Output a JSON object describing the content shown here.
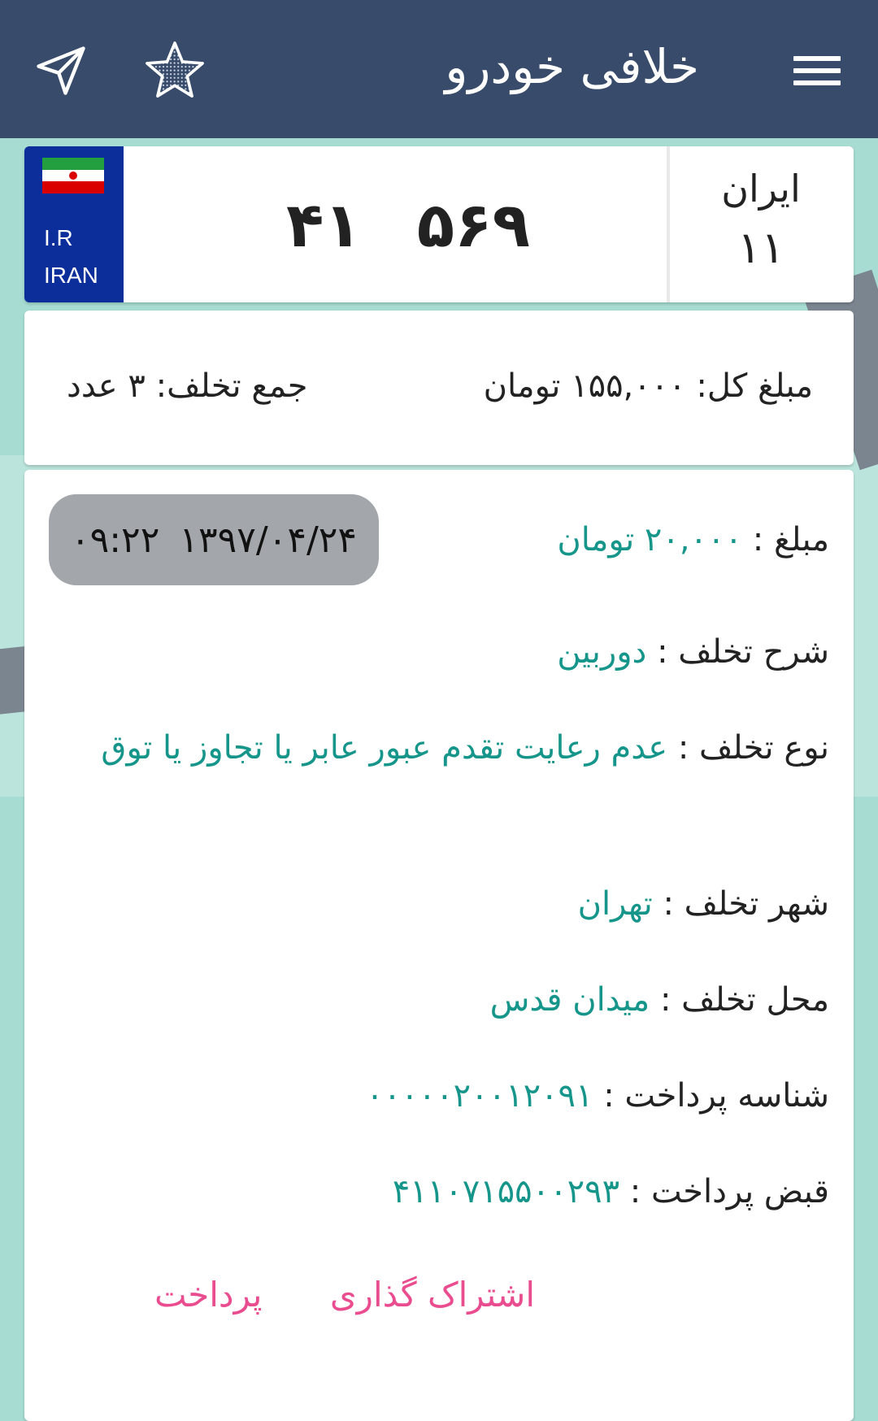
{
  "app_bar": {
    "title": "خلافی خودرو",
    "menu_icon": "hamburger-icon",
    "star_icon": "star-icon",
    "send_icon": "send-icon",
    "color": "#384b6b"
  },
  "plate": {
    "country_code": "I.R",
    "country_name": "IRAN",
    "number_left": "۴۱",
    "number_right": "۵۶۹",
    "region_label": "ایران",
    "region_code": "۱۱",
    "flag_colors": [
      "#239f40",
      "#ffffff",
      "#da0000"
    ]
  },
  "summary": {
    "total_text": "مبلغ کل: ۱۵۵,۰۰۰ تومان",
    "count_text": "جمع تخلف: ۳ عدد"
  },
  "violation": {
    "datetime_date": "۱۳۹۷/۰۴/۲۴",
    "datetime_time": "۰۹:۲۲",
    "amount_label": "مبلغ : ",
    "amount_value": "۲۰,۰۰۰ تومان",
    "description_label": "شرح تخلف : ",
    "description_value": "دوربین",
    "type_label": "نوع تخلف : ",
    "type_value": "عدم رعایت تقدم عبور عابر یا تجاوز یا توق",
    "city_label": "شهر تخلف : ",
    "city_value": "تهران",
    "location_label": "محل تخلف : ",
    "location_value": "میدان قدس",
    "payment_id_label": "شناسه پرداخت : ",
    "payment_id_value": "۰۰۰۰۰۲۰۰۱۲۰۹۱",
    "bill_id_label": "قبض پرداخت : ",
    "bill_id_value": "۴۱۱۰۷۱۵۵۰۰۲۹۳",
    "share_label": "اشتراک گذاری",
    "pay_label": "پرداخت",
    "value_color": "#16958b",
    "action_color": "#e94d8f"
  }
}
